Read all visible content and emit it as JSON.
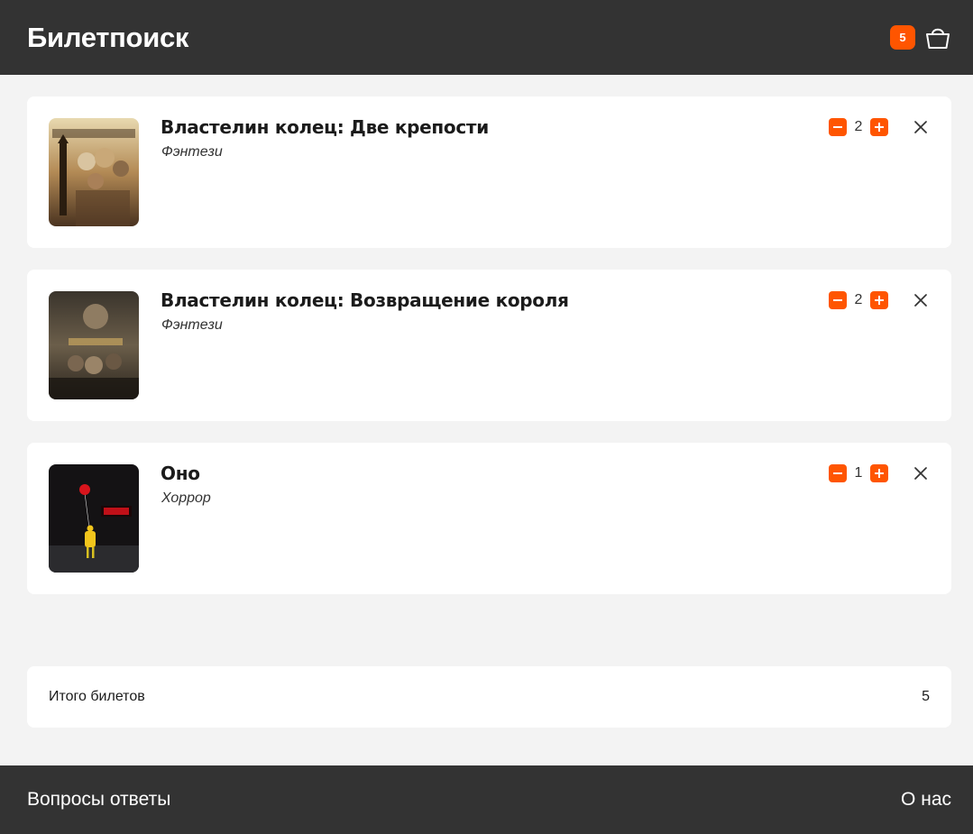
{
  "header": {
    "logo": "Билетпоиск",
    "cart_count": "5",
    "cart_icon": "basket-icon"
  },
  "cart": {
    "items": [
      {
        "title": "Властелин колец: Две крепости",
        "genre": "Фэнтези",
        "quantity": "2",
        "poster_icon": "movie-poster"
      },
      {
        "title": "Властелин колец: Возвращение короля",
        "genre": "Фэнтези",
        "quantity": "2",
        "poster_icon": "movie-poster"
      },
      {
        "title": "Оно",
        "genre": "Хоррор",
        "quantity": "1",
        "poster_icon": "movie-poster"
      }
    ]
  },
  "total": {
    "label": "Итого билетов",
    "value": "5"
  },
  "footer": {
    "faq_link": "Вопросы ответы",
    "about_link": "О нас"
  },
  "colors": {
    "accent": "#ff5500",
    "header_bg": "#333333",
    "page_bg": "#f3f3f3",
    "card_bg": "#ffffff"
  }
}
